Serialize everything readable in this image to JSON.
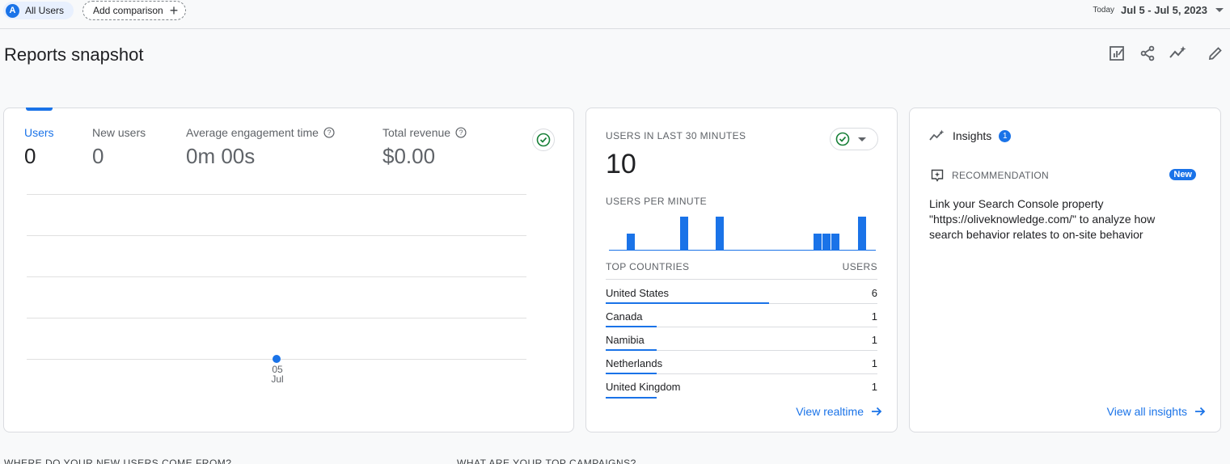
{
  "segment": {
    "avatar": "A",
    "label": "All Users"
  },
  "add_comparison": {
    "label": "Add comparison",
    "icon": "plus-icon"
  },
  "date": {
    "today": "Today",
    "range": "Jul 5 - Jul 5, 2023"
  },
  "page": {
    "title": "Reports snapshot"
  },
  "toolbar": [
    "customize-report-icon",
    "share-icon",
    "insights-icon",
    "edit-icon"
  ],
  "overview": {
    "metrics": [
      {
        "label": "Users",
        "value": "0",
        "active": true
      },
      {
        "label": "New users",
        "value": "0",
        "active": false
      },
      {
        "label": "Average engagement time",
        "value": "0m 00s",
        "active": false,
        "help": true
      },
      {
        "label": "Total revenue",
        "value": "$0.00",
        "active": false,
        "help": true
      }
    ],
    "chart_data": {
      "type": "line",
      "x": [
        "05 Jul"
      ],
      "series": [
        {
          "values": [
            0
          ]
        }
      ],
      "tick_day": "05",
      "tick_month": "Jul",
      "grid": true
    }
  },
  "realtime": {
    "heading": "USERS IN LAST 30 MINUTES",
    "value": "10",
    "per_minute_label": "USERS PER MINUTE",
    "per_minute": [
      0,
      0,
      1,
      0,
      0,
      0,
      0,
      0,
      0,
      0,
      0,
      0,
      0,
      0,
      0,
      0,
      0,
      0,
      0,
      0,
      0,
      0,
      0,
      0,
      0,
      0,
      0,
      0,
      0,
      0,
      0,
      0
    ],
    "bars": [
      {
        "index": 2,
        "value": 1
      },
      {
        "index": 8,
        "value": 2
      },
      {
        "index": 12,
        "value": 2
      },
      {
        "index": 23,
        "value": 1
      },
      {
        "index": 24,
        "value": 1
      },
      {
        "index": 25,
        "value": 1
      },
      {
        "index": 28,
        "value": 2
      }
    ],
    "countries_header": "TOP COUNTRIES",
    "users_header": "USERS",
    "countries": [
      {
        "name": "United States",
        "users": "6",
        "share": 1.0
      },
      {
        "name": "Canada",
        "users": "1",
        "share": 0.31
      },
      {
        "name": "Namibia",
        "users": "1",
        "share": 0.31
      },
      {
        "name": "Netherlands",
        "users": "1",
        "share": 0.31
      },
      {
        "name": "United Kingdom",
        "users": "1",
        "share": 0.31
      }
    ],
    "link": "View realtime"
  },
  "insights": {
    "title": "Insights",
    "count": "1",
    "rec_label": "RECOMMENDATION",
    "badge": "New",
    "text": "Link your Search Console property \"https://oliveknowledge.com/\" to analyze how search behavior relates to on-site behavior",
    "link": "View all insights"
  },
  "sections": {
    "new_users": "WHERE DO YOUR NEW USERS COME FROM?",
    "campaigns": "WHAT ARE YOUR TOP CAMPAIGNS?"
  },
  "colors": {
    "accent": "#1a73e8",
    "success": "#188038"
  }
}
